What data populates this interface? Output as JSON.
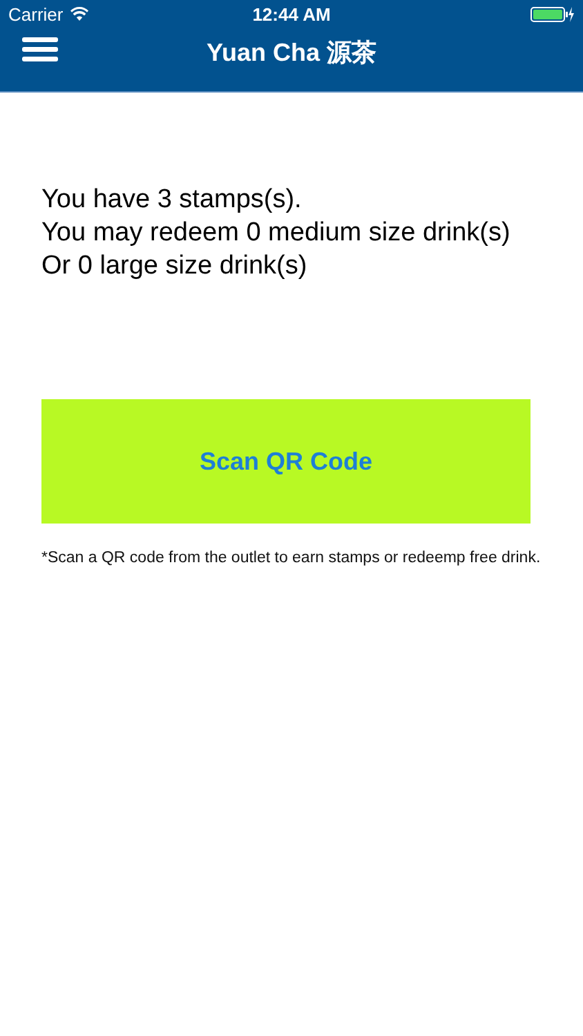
{
  "status_bar": {
    "carrier": "Carrier",
    "time": "12:44 AM"
  },
  "nav_bar": {
    "title": "Yuan Cha 源茶"
  },
  "summary": [
    "You have 3 stamps(s).",
    "You may redeem 0 medium size drink(s)",
    "Or 0 large size drink(s)"
  ],
  "scan_button": {
    "label": "Scan QR Code"
  },
  "footnote": "*Scan a QR code from the outlet to earn stamps or redeemp free drink."
}
